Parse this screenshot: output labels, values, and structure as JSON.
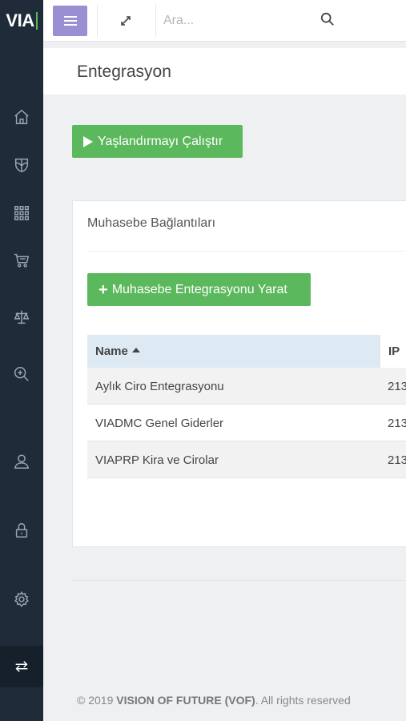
{
  "brand": {
    "logo_text": "VIA"
  },
  "topbar": {
    "search_placeholder": "Ara..."
  },
  "page": {
    "title": "Entegrasyon"
  },
  "actions": {
    "run_aging_label": "Yaşlandırmayı Çalıştır"
  },
  "panel": {
    "title": "Muhasebe Bağlantıları",
    "create_label": "Muhasebe Entegrasyonu Yarat",
    "create_icon": "+"
  },
  "table": {
    "columns": [
      "Name",
      "IP"
    ],
    "rows": [
      {
        "name": "Aylık Ciro Entegrasyonu",
        "ip": "213"
      },
      {
        "name": "VIADMC Genel Giderler",
        "ip": "213"
      },
      {
        "name": "VIAPRP Kira ve Cirolar",
        "ip": "213"
      }
    ]
  },
  "footer": {
    "prefix": "© 2019",
    "company": "VISION OF FUTURE (VOF)",
    "suffix": ". All rights reserved"
  },
  "colors": {
    "sidebar": "#1f2b38",
    "menu_button": "#9b8fd3",
    "primary_green": "#5cb85c",
    "table_header": "#ddeaf4"
  },
  "icons": {
    "sidebar": [
      "home-icon",
      "shield-icon",
      "grid-icon",
      "cart-icon",
      "balance-scale-icon",
      "zoom-in-icon",
      "user-icon",
      "lock-icon",
      "gear-icon",
      "exchange-icon"
    ],
    "topbar": [
      "hamburger-menu-icon",
      "expand-icon",
      "search-icon"
    ]
  }
}
